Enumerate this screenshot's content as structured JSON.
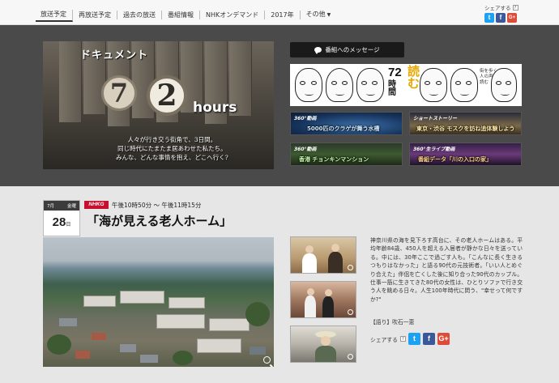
{
  "nav": {
    "items": [
      {
        "label": "放送予定"
      },
      {
        "label": "再放送予定"
      },
      {
        "label": "過去の放送"
      },
      {
        "label": "番組情報"
      },
      {
        "label": "NHKオンデマンド"
      },
      {
        "label": "2017年"
      },
      {
        "label": "その他"
      }
    ]
  },
  "share_top": {
    "label": "シェアする",
    "help": "?",
    "twitter": "t",
    "facebook": "f",
    "google": "G+"
  },
  "hero": {
    "docu": "ドキュメント",
    "num7": "7",
    "num2": "2",
    "hours": "hours",
    "tagline1": "人々が行き交う街角で、3日間。",
    "tagline2": "同じ時代にたまたま居あわせた私たち。",
    "tagline3": "みんな、どんな事情を抱え、どこへ行く?"
  },
  "message_button": {
    "label": "番組へのメッセージ"
  },
  "banner72": {
    "num": "72",
    "yomu": "読む",
    "jikan": "時間",
    "side": "街を歩く人の声を読む"
  },
  "videos": [
    {
      "tag": "360°動画",
      "title": "5000匹のクラゲが舞う水槽"
    },
    {
      "tag": "ショートストーリー",
      "title": "東京・渋谷 モスクを訪ね追体験しよう"
    },
    {
      "tag": "360°動画",
      "title": "香港 チョンキンマンション"
    },
    {
      "tag": "360°生ライブ動画",
      "title": "番組データ「川の入口の家」"
    }
  ],
  "episode": {
    "month": "7月",
    "weekday": "金曜",
    "day": "28",
    "day_suffix": "日",
    "channel": "NHKG",
    "airtime": "午後10時50分 〜 午後11時15分",
    "title": "「海が見える老人ホーム」",
    "description": "神奈川県の海を見下ろす高台に、その老人ホームはある。平均年齢84歳、450人を超える入居者が静かな日々を送っている。中には、30年ここで過ごす人も。「こんなに長く生きるつもりはなかった」と語る90代の元技術者。「いい人とめぐり合えた」伴侶を亡くした後に知り合った90代のカップル。仕事一筋に生きてきた80代の女性は、ひとりソファで行き交う人を眺める日々。人生100年時代に問う、\"幸せって何ですか?\"",
    "narration": "【語り】吹石一恵",
    "share_label": "シェアする",
    "share_help": "?"
  },
  "colors": {
    "nhk_red": "#c8102e",
    "twitter": "#1da1f2",
    "facebook": "#3b5998",
    "google": "#dd4b39"
  }
}
